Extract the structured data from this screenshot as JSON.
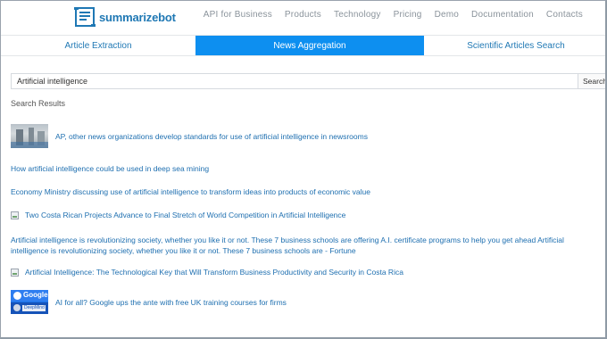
{
  "brand": {
    "name": "summarizebot"
  },
  "nav": {
    "items": [
      "API for Business",
      "Products",
      "Technology",
      "Pricing",
      "Demo",
      "Documentation",
      "Contacts"
    ]
  },
  "tabs": [
    {
      "label": "Article Extraction",
      "active": false
    },
    {
      "label": "News Aggregation",
      "active": true
    },
    {
      "label": "Scientific Articles Search",
      "active": false
    }
  ],
  "search": {
    "value": "Artificial intelligence",
    "button_label": "Search"
  },
  "results_label": "Search Results",
  "results": [
    {
      "title": "AP, other news organizations develop standards for use of artificial intelligence in newsrooms",
      "thumb": "photo-icon"
    },
    {
      "title": "How artificial intelligence could be used in deep sea mining",
      "thumb": "none"
    },
    {
      "title": "Economy Ministry discussing use of artificial intelligence to transform ideas into products of economic value",
      "thumb": "none"
    },
    {
      "title": "Two Costa Rican Projects Advance to Final Stretch of World Competition in Artificial Intelligence",
      "thumb": "broken-image-icon"
    },
    {
      "title": "Artificial intelligence is revolutionizing society, whether you like it or not. These 7 business schools are offering A.I. certificate programs to help you get ahead Artificial intelligence is revolutionizing society, whether you like it or not. These 7 business schools are - Fortune",
      "thumb": "none"
    },
    {
      "title": "Artificial Intelligence: The Technological Key that Will Transform Business Productivity and Security in Costa Rica",
      "thumb": "broken-image-icon"
    },
    {
      "title": "AI for all? Google ups the ante with free UK training courses for firms",
      "thumb": "google-deepmind-icon"
    }
  ],
  "thumb_google": {
    "top_text": "Google",
    "bottom_text": "DeepMind"
  },
  "colors": {
    "accent": "#0d8ff0",
    "link": "#1e6fb0",
    "brand": "#1f78b4"
  }
}
